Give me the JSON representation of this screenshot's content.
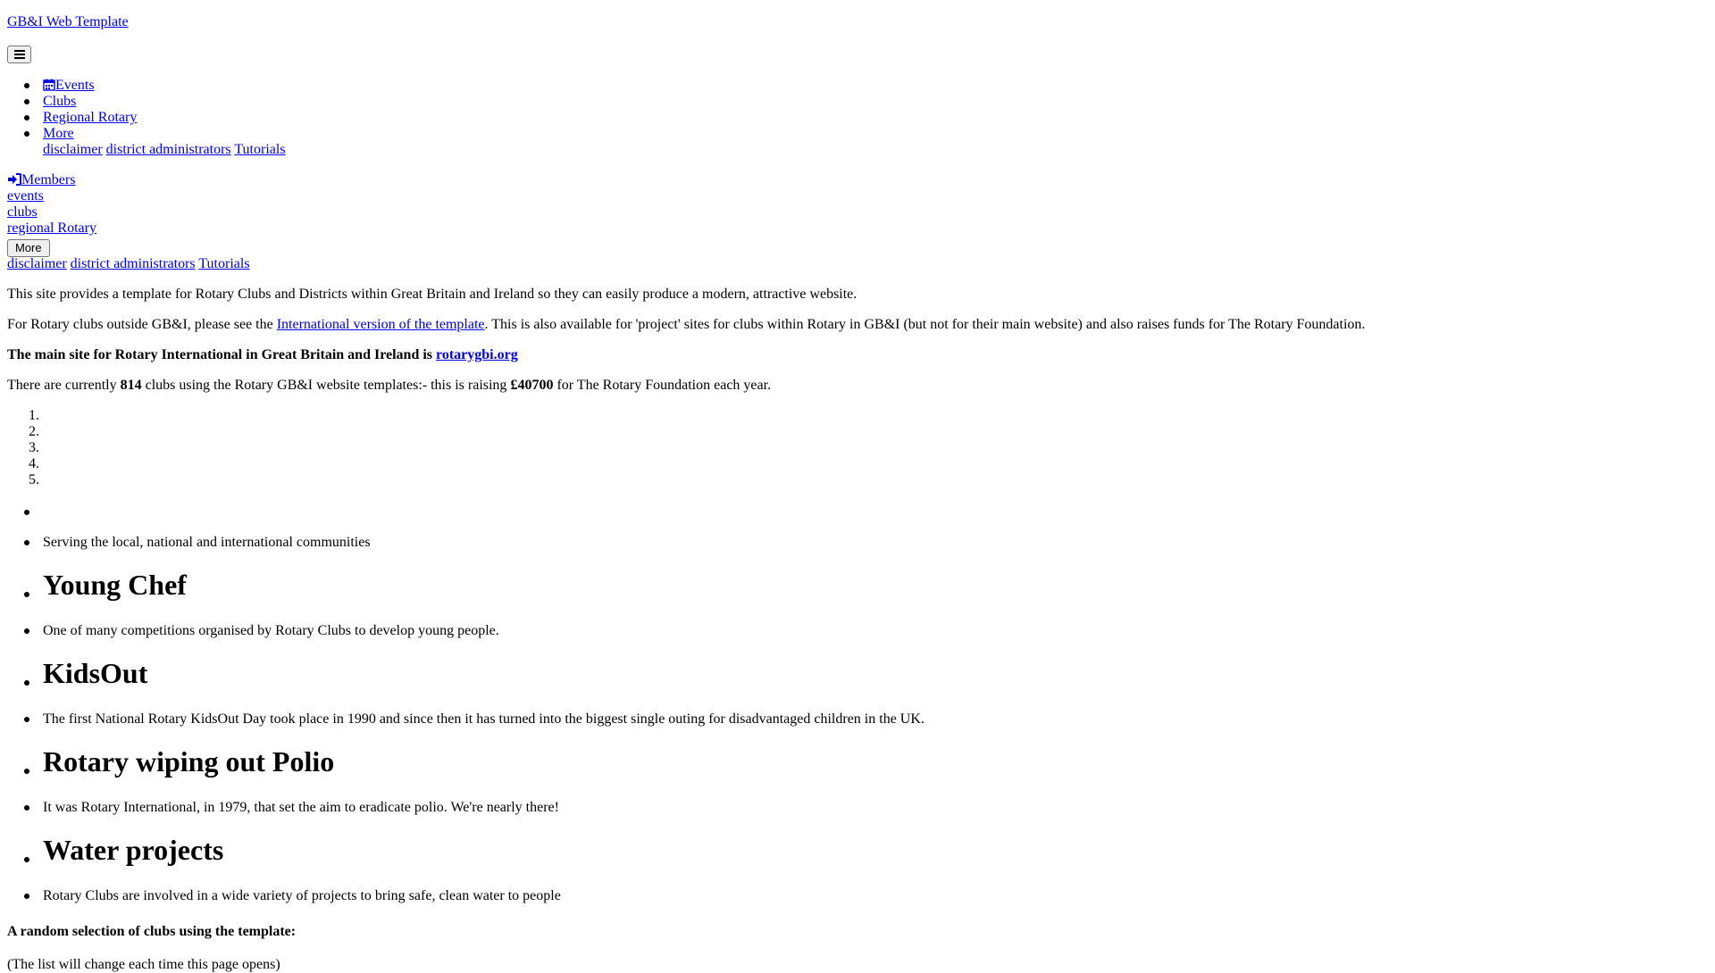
{
  "brand": {
    "label": "GB&I Web Template"
  },
  "nav": {
    "menu_toggle_icon": "hamburger-icon",
    "items": [
      {
        "label": "Events",
        "icon": "calendar-icon"
      },
      {
        "label": "Clubs"
      },
      {
        "label": "Regional Rotary"
      },
      {
        "label": "More"
      }
    ],
    "more_submenu": [
      "disclaimer",
      "district administrators",
      "Tutorials"
    ]
  },
  "members": {
    "label": "Members",
    "icon": "sign-in-icon"
  },
  "mobile_nav": {
    "items": [
      "events",
      "clubs",
      "regional Rotary"
    ],
    "more_button": "More",
    "more_submenu": [
      "disclaimer",
      "district administrators",
      "Tutorials"
    ]
  },
  "intro": {
    "p1": "This site provides a template for Rotary Clubs and Districts within Great Britain and Ireland so they can easily produce a modern, attractive website.",
    "p2_before": "For Rotary clubs outside GB&I, please see the ",
    "p2_link": "International version of the template",
    "p2_after": ". This is also available for 'project' sites for clubs within Rotary in GB&I (but not for their main website) and also raises funds for The Rotary Foundation.",
    "p3_text": "The main site for Rotary International in Great Britain and Ireland is ",
    "p3_link": "rotarygbi.org",
    "p4_before": "There are currently ",
    "p4_count": "814",
    "p4_middle": " clubs using the Rotary GB&I website templates:- this is raising ",
    "p4_amount": "£40700",
    "p4_after": " for The Rotary Foundation each year."
  },
  "carousel": {
    "indicators": [
      "1.",
      "2.",
      "3.",
      "4.",
      "5."
    ],
    "first_caption": "Serving the local, national and international communities",
    "slides": [
      {
        "title": "Young Chef",
        "caption": "One of many competitions organised by Rotary Clubs to develop young people."
      },
      {
        "title": "KidsOut",
        "caption": "The first National Rotary KidsOut Day took place in 1990 and since then it has turned into the biggest single outing for disadvantaged children in the UK."
      },
      {
        "title": "Rotary wiping out Polio",
        "caption": "It was Rotary International, in 1979, that set the aim to eradicate polio. We're nearly there!"
      },
      {
        "title": "Water projects",
        "caption": "Rotary Clubs are involved in a wide variety of projects to bring safe, clean water to people"
      }
    ]
  },
  "random_clubs": {
    "heading": "A random selection of clubs using the template:",
    "note": "(The list will change each time this page opens)"
  }
}
